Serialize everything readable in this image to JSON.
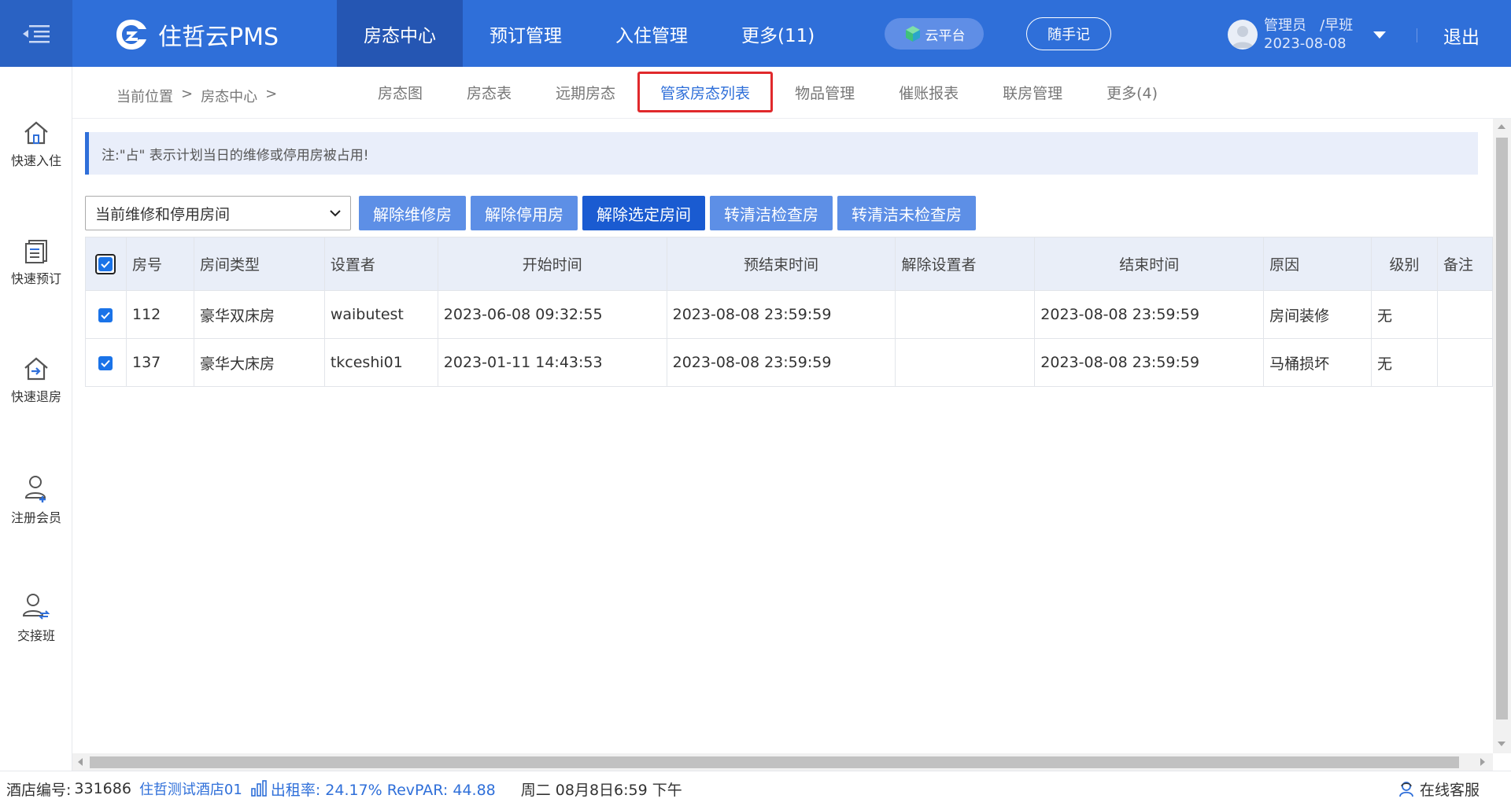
{
  "app": {
    "logo_text": "住哲云PMS"
  },
  "nav": {
    "items": [
      "房态中心",
      "预订管理",
      "入住管理",
      "更多(11)"
    ]
  },
  "header": {
    "cloud_label": "云平台",
    "note_label": "随手记",
    "user_role": "管理员",
    "user_shift": "/早班",
    "user_date": "2023-08-08",
    "logout_label": "退出"
  },
  "sidebar": {
    "items": [
      "快速入住",
      "快速预订",
      "快速退房",
      "注册会员",
      "交接班"
    ]
  },
  "breadcrumb": {
    "label": "当前位置",
    "sep": ">",
    "current": "房态中心",
    "sep2": ">"
  },
  "subtabs": [
    "房态图",
    "房态表",
    "远期房态",
    "管家房态列表",
    "物品管理",
    "催账报表",
    "联房管理",
    "更多(4)"
  ],
  "notice": "注:\"占\" 表示计划当日的维修或停用房被占用!",
  "filter": {
    "selected": "当前维修和停用房间"
  },
  "buttons": [
    "解除维修房",
    "解除停用房",
    "解除选定房间",
    "转清洁检查房",
    "转清洁未检查房"
  ],
  "table": {
    "headers": [
      "房号",
      "房间类型",
      "设置者",
      "开始时间",
      "预结束时间",
      "解除设置者",
      "结束时间",
      "原因",
      "级别",
      "备注"
    ],
    "rows": [
      [
        "112",
        "豪华双床房",
        "waibutest",
        "2023-06-08 09:32:55",
        "2023-08-08 23:59:59",
        "",
        "2023-08-08 23:59:59",
        "房间装修",
        "无",
        ""
      ],
      [
        "137",
        "豪华大床房",
        "tkceshi01",
        "2023-01-11 14:43:53",
        "2023-08-08 23:59:59",
        "",
        "2023-08-08 23:59:59",
        "马桶损坏",
        "无",
        ""
      ]
    ]
  },
  "status": {
    "hotel_code_label": "酒店编号:",
    "hotel_code": "331686",
    "hotel_name": "住哲测试酒店01",
    "occupancy": "出租率: 24.17% RevPAR: 44.88",
    "datetime": "周二 08月8日6:59 下午",
    "support": "在线客服"
  },
  "colors": {
    "brand": "#2f6fd9",
    "button": "#5d8fe6",
    "button_active": "#1a5bd1",
    "highlight_border": "#e0292c"
  }
}
